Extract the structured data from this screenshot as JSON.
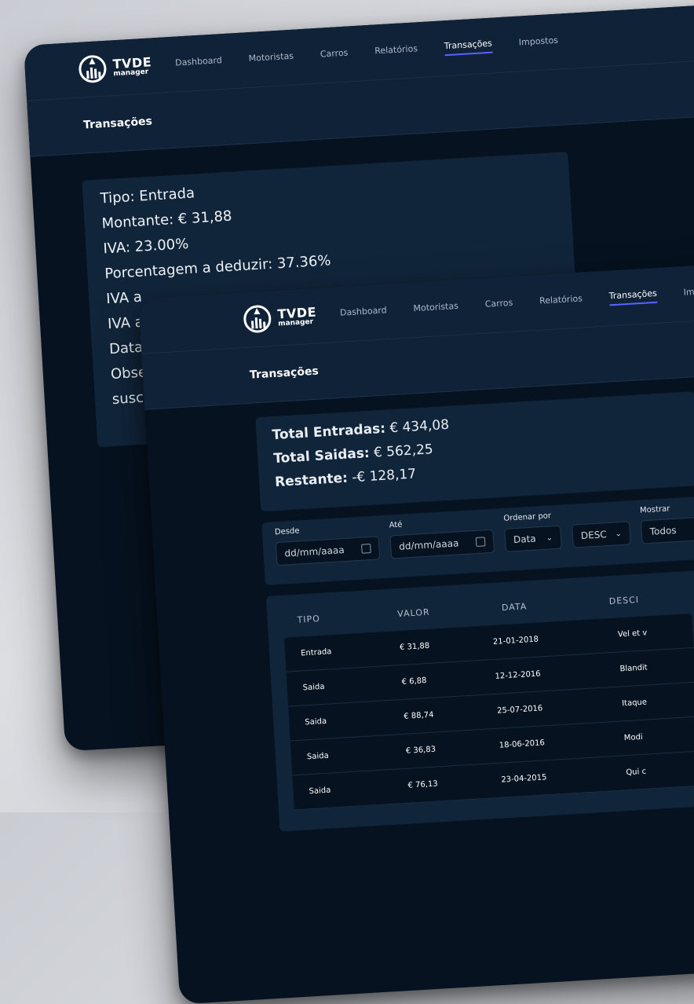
{
  "brand": {
    "title": "TVDE",
    "subtitle": "manager"
  },
  "nav": [
    {
      "label": "Dashboard"
    },
    {
      "label": "Motoristas"
    },
    {
      "label": "Carros"
    },
    {
      "label": "Relatórios"
    },
    {
      "label": "Transações",
      "active": true
    },
    {
      "label": "Impostos"
    }
  ],
  "page_title": "Transações",
  "detail": {
    "lines": [
      "Tipo: Entrada",
      "Montante: € 31,88",
      "IVA: 23.00%",
      "Porcentagem a deduzir: 37.36%",
      "IVA a",
      "IVA a",
      "Data d",
      "Obser",
      "suscip"
    ]
  },
  "totals": {
    "entradas_label": "Total Entradas:",
    "entradas_value": "€ 434,08",
    "saidas_label": "Total Saidas:",
    "saidas_value": "€ 562,25",
    "restante_label": "Restante:",
    "restante_value": "-€ 128,17"
  },
  "filters": {
    "desde_label": "Desde",
    "desde_placeholder": "dd/mm/aaaa",
    "ate_label": "Até",
    "ate_placeholder": "dd/mm/aaaa",
    "ordenar_label": "Ordenar por",
    "ordenar_value": "Data",
    "direcao_value": "DESC",
    "mostrar_label": "Mostrar",
    "mostrar_value": "Todos"
  },
  "table": {
    "headers": [
      "TIPO",
      "VALOR",
      "DATA",
      "DESCI"
    ],
    "rows": [
      {
        "tipo": "Entrada",
        "valor": "€ 31,88",
        "data": "21-01-2018",
        "desc": "Vel et v"
      },
      {
        "tipo": "Saida",
        "valor": "€ 6,88",
        "data": "12-12-2016",
        "desc": "Blandit"
      },
      {
        "tipo": "Saida",
        "valor": "€ 88,74",
        "data": "25-07-2016",
        "desc": "Itaque"
      },
      {
        "tipo": "Saida",
        "valor": "€ 36,83",
        "data": "18-06-2016",
        "desc": "Modi"
      },
      {
        "tipo": "Saida",
        "valor": "€ 76,13",
        "data": "23-04-2015",
        "desc": "Qui c"
      }
    ]
  },
  "colors": {
    "background": "#06121f",
    "panel": "#102237",
    "card": "#11253a",
    "accent": "#5a63ff"
  }
}
